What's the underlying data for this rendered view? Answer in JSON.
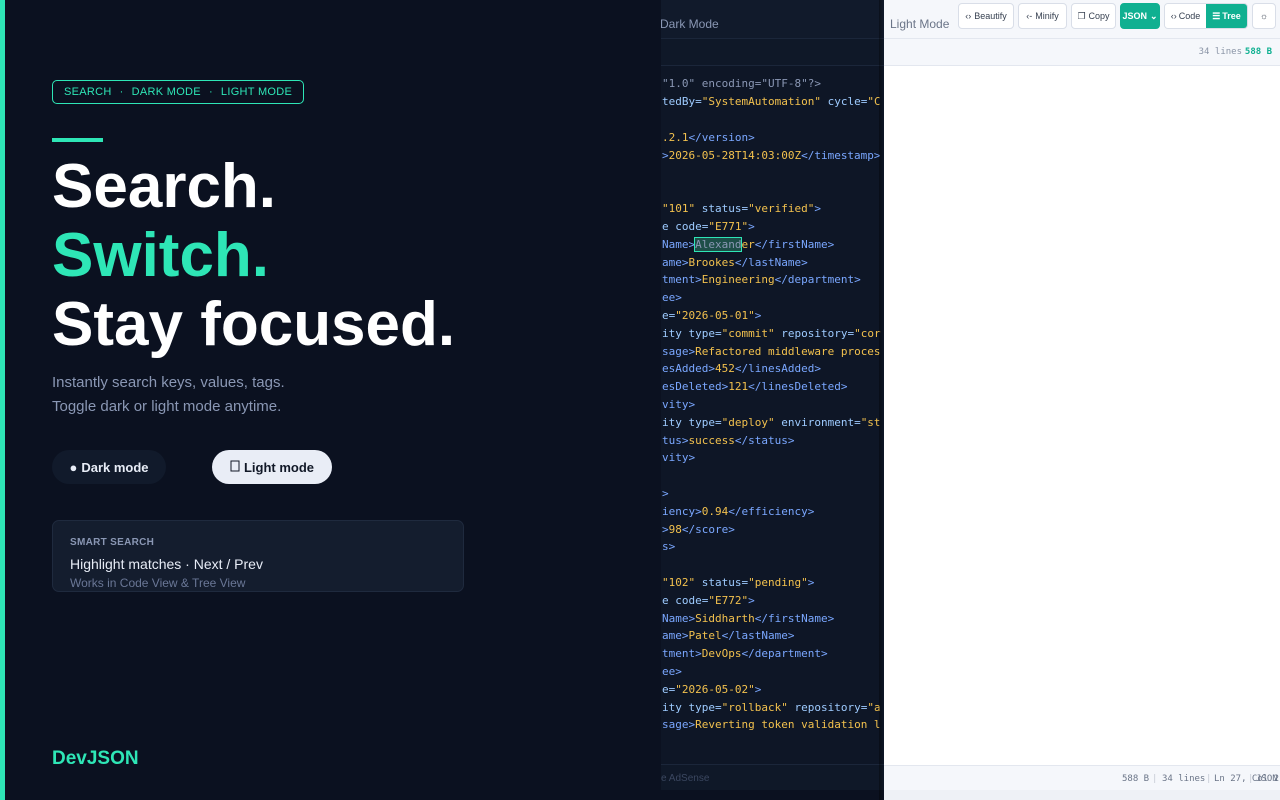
{
  "hero": {
    "tags": [
      "SEARCH",
      "DARK MODE",
      "LIGHT MODE"
    ],
    "tag_separator": "·",
    "line1": "Search.",
    "line2": "Switch.",
    "line3": "Stay focused.",
    "sub1": "Instantly search keys, values, tags.",
    "sub2": "Toggle dark or light mode anytime.",
    "dark_button": "Dark mode",
    "light_button": "Light mode"
  },
  "card": {
    "title": "SMART SEARCH",
    "main": "Highlight matches · Next / Prev",
    "sub": "Works in Code View & Tree View"
  },
  "brand": "DevJSON",
  "dark_panel": {
    "title": "Dark Mode",
    "footer_text": "e AdSense"
  },
  "light_panel": {
    "title": "Light Mode",
    "toolbar": {
      "beautify": "Beautify",
      "minify": "Minify",
      "copy": "Copy",
      "format": "JSON",
      "code": "Code",
      "tree": "Tree"
    },
    "sub": {
      "lines": "34 lines",
      "bytes": "588 B"
    },
    "status": {
      "bytes": "588 B",
      "lines": "34 lines",
      "position": "Ln 27, Col 2",
      "lang": "JSON"
    }
  },
  "colors": {
    "accent": "#2ee6b6",
    "background": "#0a0f1c",
    "green_button": "#10b091"
  }
}
